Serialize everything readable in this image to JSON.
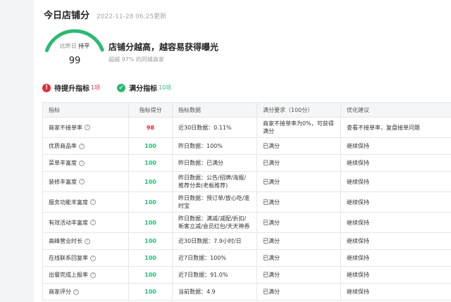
{
  "header": {
    "title": "今日店铺分",
    "update_time": "2022-11-28 06:25更新"
  },
  "gauge": {
    "label_prefix": "比昨日",
    "label_status": "持平",
    "score": "99",
    "fill_fraction": 0.99,
    "color": "#2bba73",
    "track_color": "#e5e7ea"
  },
  "summary": {
    "headline": "店铺分越高，越容易获得曝光",
    "subline": "超越 97% 的同城商家"
  },
  "tags": {
    "improve_label": "待提升指标",
    "improve_count": "1项",
    "full_label": "满分指标",
    "full_count": "10项"
  },
  "table": {
    "headers": [
      "指标",
      "指标得分",
      "指标数据",
      "满分要求（100分）",
      "优化建议"
    ],
    "rows": [
      {
        "name": "商家不接单率",
        "score": "98",
        "data": "近30日数据：0.11%",
        "req": "商家不接单率为0%，可获得满分",
        "advice": "查看不接单率，复盘接单问题"
      },
      {
        "name": "优质商品率",
        "score": "100",
        "data": "昨日数据：100%",
        "req": "已满分",
        "advice": "继续保持"
      },
      {
        "name": "菜单丰富度",
        "score": "100",
        "data": "昨日数据：已满分",
        "req": "已满分",
        "advice": "继续保持"
      },
      {
        "name": "装修丰富度",
        "score": "100",
        "data": "昨日数据：公告/招牌/海报/推荐分类(老板推荐)",
        "req": "已满分",
        "advice": "继续保持"
      },
      {
        "name": "服务功能丰富度",
        "score": "100",
        "data": "昨日数据：预订单/放心吃/准时宝",
        "req": "已满分",
        "advice": "继续保持"
      },
      {
        "name": "有效活动丰富度",
        "score": "100",
        "data": "昨日数据：满减/减配/折扣/新客立减/会员红包/天天神券",
        "req": "已满分",
        "advice": "继续保持"
      },
      {
        "name": "高峰营业时长",
        "score": "100",
        "data": "近30日数据：7.9小时/日",
        "req": "已满分",
        "advice": "继续保持"
      },
      {
        "name": "在线联系回复率",
        "score": "100",
        "data": "近7日数据：100%",
        "req": "已满分",
        "advice": "继续保持"
      },
      {
        "name": "出餐完成上报率",
        "score": "100",
        "data": "近7日数据：91.0%",
        "req": "已满分",
        "advice": "继续保持"
      },
      {
        "name": "商家评分",
        "score": "100",
        "data": "当前数据：4.9",
        "req": "已满分",
        "advice": "继续保持"
      }
    ]
  },
  "colors": {
    "accent_green": "#2bba73",
    "alert_red": "#e02d3c"
  }
}
